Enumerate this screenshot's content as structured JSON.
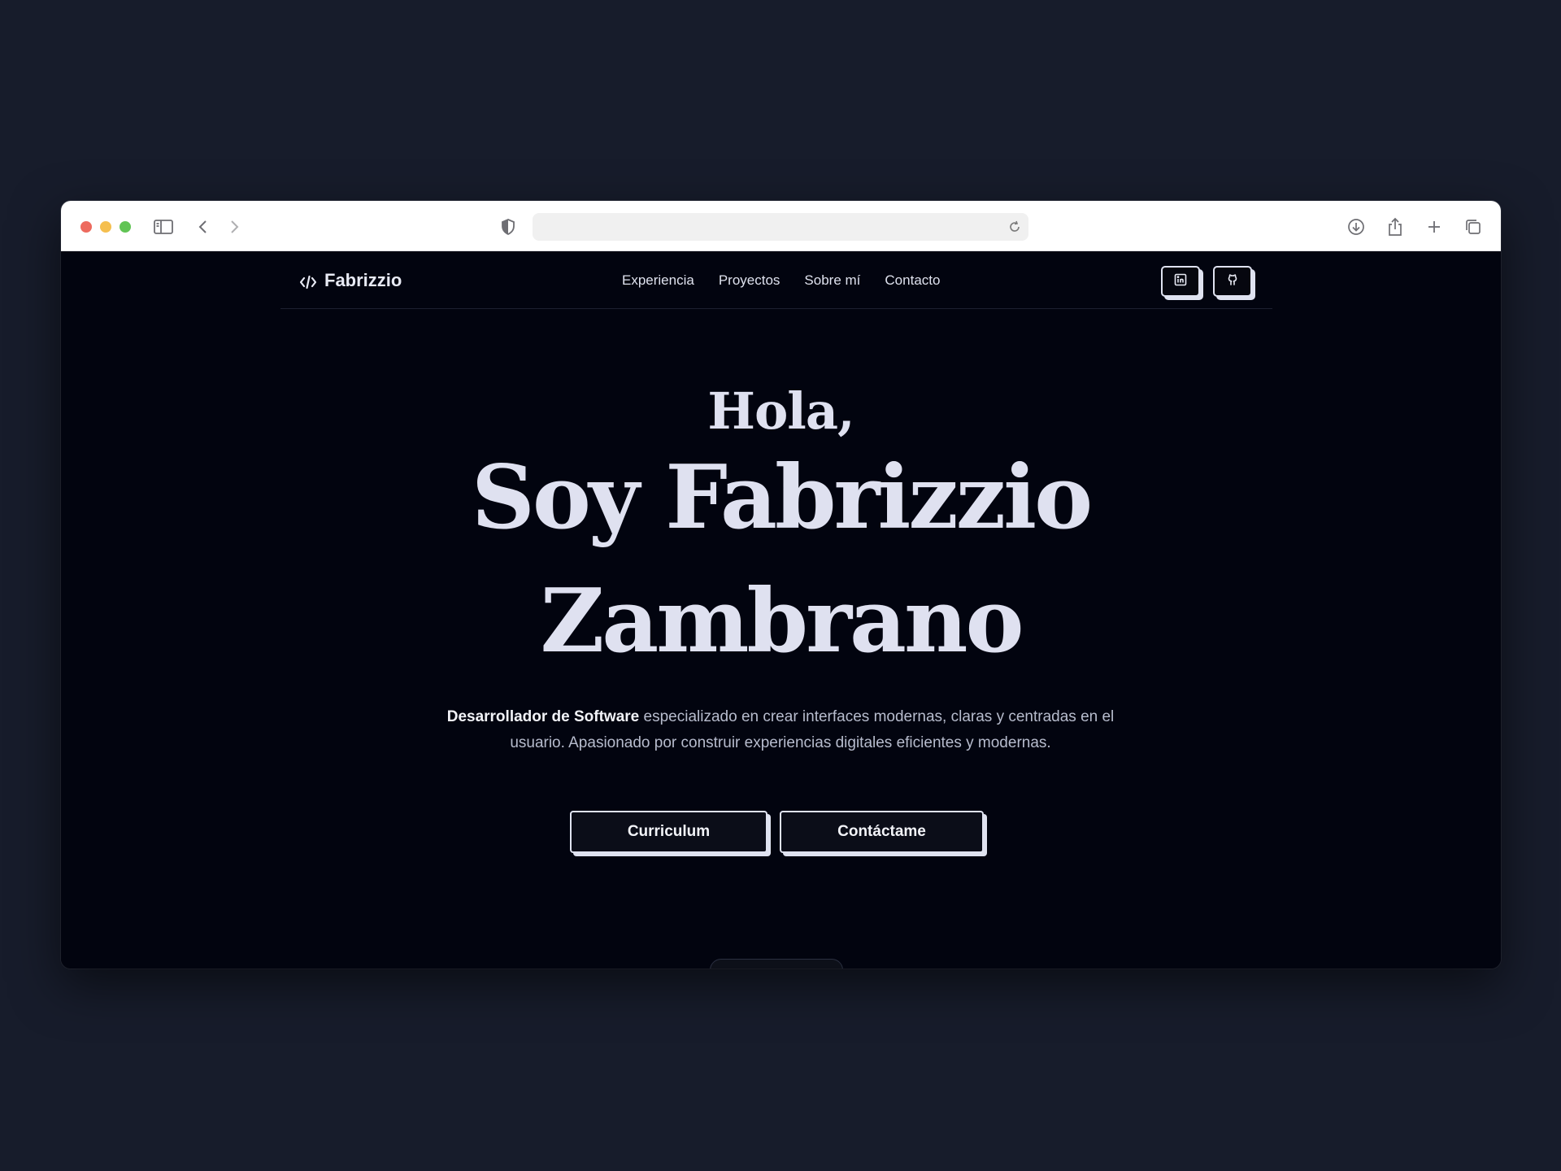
{
  "browser": {
    "url": ""
  },
  "nav": {
    "brand": "Fabrizzio",
    "links": [
      "Experiencia",
      "Proyectos",
      "Sobre mí",
      "Contacto"
    ]
  },
  "hero": {
    "greeting": "Hola,",
    "name_line1": "Soy Fabrizzio",
    "name_line2": "Zambrano",
    "description_bold": "Desarrollador de Software",
    "description_rest": " especializado en crear interfaces modernas, claras y centradas en el usuario. Apasionado por construir experiencias digitales eficientes y modernas.",
    "button_cv": "Curriculum",
    "button_contact": "Contáctame"
  },
  "colors": {
    "background": "#171c2b",
    "page": "#02040f",
    "text": "#dfe1f0"
  }
}
